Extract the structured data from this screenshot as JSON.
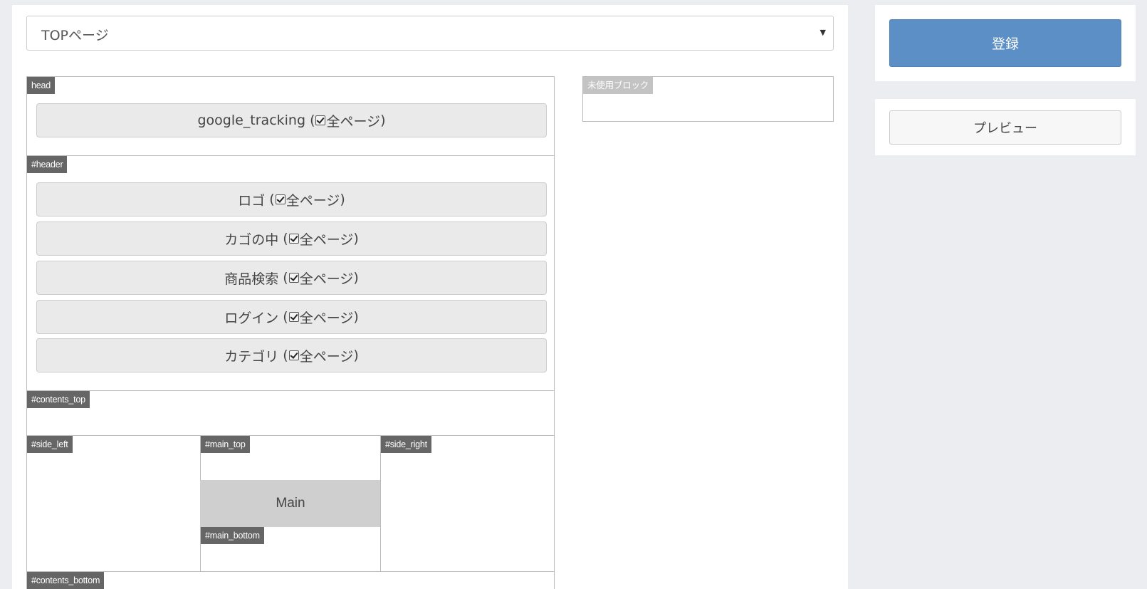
{
  "page_select": {
    "value": "TOPページ"
  },
  "layout": {
    "head": {
      "label": "head",
      "blocks": [
        {
          "name": "google_tracking",
          "checkbox_label": "全ページ"
        }
      ]
    },
    "header": {
      "label": "#header",
      "blocks": [
        {
          "name": "ロゴ",
          "checkbox_label": "全ページ"
        },
        {
          "name": "カゴの中",
          "checkbox_label": "全ページ"
        },
        {
          "name": "商品検索",
          "checkbox_label": "全ページ"
        },
        {
          "name": "ログイン",
          "checkbox_label": "全ページ"
        },
        {
          "name": "カテゴリ",
          "checkbox_label": "全ページ"
        }
      ]
    },
    "contents_top": {
      "label": "#contents_top"
    },
    "side_left": {
      "label": "#side_left"
    },
    "main_top": {
      "label": "#main_top"
    },
    "main": {
      "label": "Main"
    },
    "main_bottom": {
      "label": "#main_bottom"
    },
    "side_right": {
      "label": "#side_right"
    },
    "contents_bottom": {
      "label": "#contents_bottom"
    }
  },
  "unused_blocks": {
    "label": "未使用ブロック"
  },
  "actions": {
    "register_label": "登録",
    "preview_label": "プレビュー"
  },
  "colors": {
    "primary": "#5b8fc5",
    "tag": "#666666",
    "block_bg": "#eaeaea",
    "main_bg": "#cfcfcf",
    "page_bg": "#ecedf1"
  }
}
